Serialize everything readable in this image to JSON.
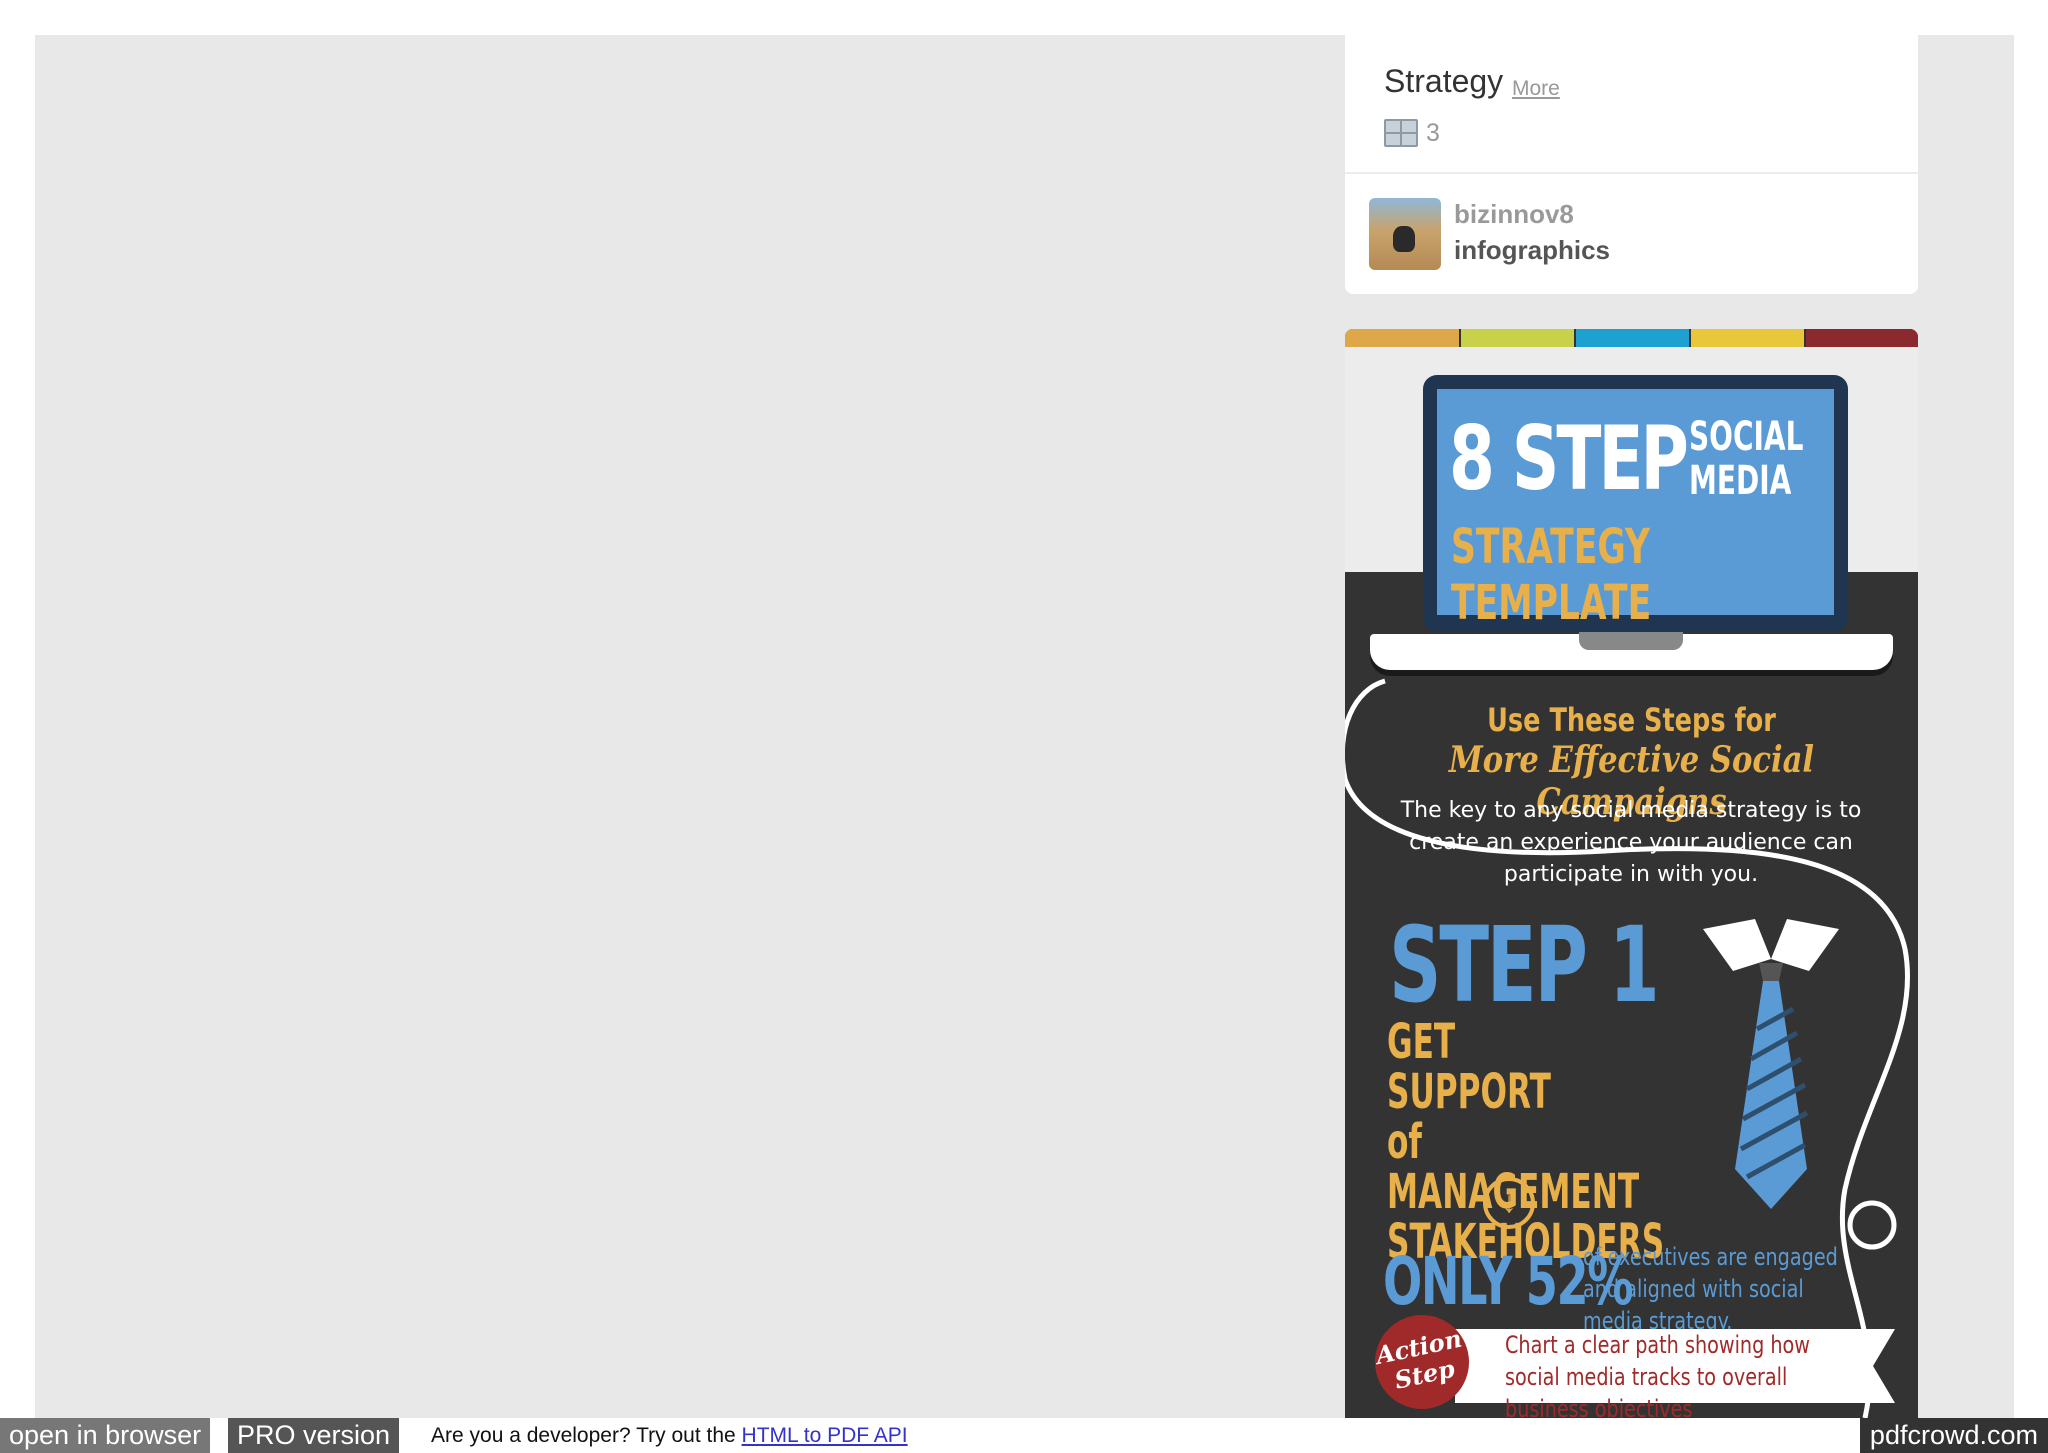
{
  "board": {
    "title": "Strategy",
    "more_label": "More",
    "pin_count": "3",
    "user_name": "bizinnov8",
    "board_name": "infographics"
  },
  "pin": {
    "stripe_colors": [
      "#dda74a",
      "#c7d24a",
      "#1ea1d1",
      "#e8c73a",
      "#8b2a2e"
    ],
    "screen_big": "8 STEP",
    "screen_small": "SOCIAL MEDIA",
    "screen_sub": "STRATEGY TEMPLATE",
    "headline1": "Use These Steps for",
    "headline2": "More Effective Social Campaigns",
    "intro": "The key to any social media strategy is to create an experience your audience can participate in with you.",
    "step_number": "STEP 1",
    "step_title": "GET SUPPORT of\nMANAGEMENT\nSTAKEHOLDERS",
    "only_stat": "ONLY 52%",
    "only_note": "of executives are engaged and aligned with social media strategy.",
    "action_badge": "Action\nStep",
    "action_text": "Chart a clear path showing how social media tracks to overall business objectives"
  },
  "footer": {
    "open_in_browser": "open in browser",
    "pro_version": "PRO version",
    "dev_text": "Are you a developer? Try out the ",
    "dev_link": "HTML to PDF API",
    "brand": "pdfcrowd.com"
  }
}
